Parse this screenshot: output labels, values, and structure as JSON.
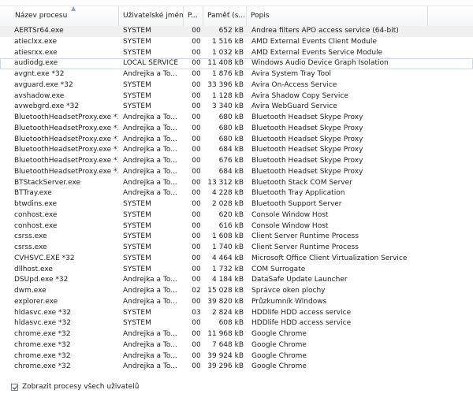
{
  "columns": {
    "name": "Název procesu",
    "user": "Uživatelské jméno",
    "priority": "P...",
    "memory": "Paměť (s...",
    "description": "Popis"
  },
  "rows": [
    {
      "name": "AERTSr64.exe",
      "user": "SYSTEM",
      "priority": "00",
      "memory": "652 kB",
      "description": "Andrea filters APO access service (64-bit)"
    },
    {
      "name": "atieclxx.exe",
      "user": "SYSTEM",
      "priority": "00",
      "memory": "1 516 kB",
      "description": "AMD External Events Client Module"
    },
    {
      "name": "atiesrxx.exe",
      "user": "SYSTEM",
      "priority": "00",
      "memory": "1 032 kB",
      "description": "AMD External Events Service Module"
    },
    {
      "name": "audiodg.exe",
      "user": "LOCAL SERVICE",
      "priority": "00",
      "memory": "11 408 kB",
      "description": "Windows Audio Device Graph Isolation"
    },
    {
      "name": "avgnt.exe *32",
      "user": "Andrejka a To...",
      "priority": "00",
      "memory": "1 876 kB",
      "description": "Avira System Tray Tool"
    },
    {
      "name": "avguard.exe *32",
      "user": "SYSTEM",
      "priority": "00",
      "memory": "33 396 kB",
      "description": "Avira On-Access Service"
    },
    {
      "name": "avshadow.exe",
      "user": "SYSTEM",
      "priority": "00",
      "memory": "1 128 kB",
      "description": "Avira Shadow Copy Service"
    },
    {
      "name": "avwebgrd.exe *32",
      "user": "SYSTEM",
      "priority": "00",
      "memory": "3 340 kB",
      "description": "Avira WebGuard Service"
    },
    {
      "name": "BluetoothHeadsetProxy.exe *32",
      "user": "Andrejka a To...",
      "priority": "00",
      "memory": "680 kB",
      "description": "Bluetooth Headset Skype Proxy"
    },
    {
      "name": "BluetoothHeadsetProxy.exe *32",
      "user": "Andrejka a To...",
      "priority": "00",
      "memory": "680 kB",
      "description": "Bluetooth Headset Skype Proxy"
    },
    {
      "name": "BluetoothHeadsetProxy.exe *32",
      "user": "Andrejka a To...",
      "priority": "00",
      "memory": "680 kB",
      "description": "Bluetooth Headset Skype Proxy"
    },
    {
      "name": "BluetoothHeadsetProxy.exe *32",
      "user": "Andrejka a To...",
      "priority": "00",
      "memory": "684 kB",
      "description": "Bluetooth Headset Skype Proxy"
    },
    {
      "name": "BluetoothHeadsetProxy.exe *32",
      "user": "Andrejka a To...",
      "priority": "00",
      "memory": "676 kB",
      "description": "Bluetooth Headset Skype Proxy"
    },
    {
      "name": "BluetoothHeadsetProxy.exe *32",
      "user": "Andrejka a To...",
      "priority": "00",
      "memory": "684 kB",
      "description": "Bluetooth Headset Skype Proxy"
    },
    {
      "name": "BTStackServer.exe",
      "user": "Andrejka a To...",
      "priority": "00",
      "memory": "13 312 kB",
      "description": "Bluetooth Stack COM Server"
    },
    {
      "name": "BTTray.exe",
      "user": "Andrejka a To...",
      "priority": "00",
      "memory": "4 228 kB",
      "description": "Bluetooth Tray Application"
    },
    {
      "name": "btwdins.exe",
      "user": "SYSTEM",
      "priority": "00",
      "memory": "2 028 kB",
      "description": "Bluetooth Support Server"
    },
    {
      "name": "conhost.exe",
      "user": "SYSTEM",
      "priority": "00",
      "memory": "620 kB",
      "description": "Console Window Host"
    },
    {
      "name": "conhost.exe",
      "user": "SYSTEM",
      "priority": "00",
      "memory": "616 kB",
      "description": "Console Window Host"
    },
    {
      "name": "csrss.exe",
      "user": "SYSTEM",
      "priority": "00",
      "memory": "1 608 kB",
      "description": "Client Server Runtime Process"
    },
    {
      "name": "csrss.exe",
      "user": "SYSTEM",
      "priority": "00",
      "memory": "1 740 kB",
      "description": "Client Server Runtime Process"
    },
    {
      "name": "CVHSVC.EXE *32",
      "user": "SYSTEM",
      "priority": "00",
      "memory": "4 464 kB",
      "description": "Microsoft Office Client Virtualization Service"
    },
    {
      "name": "dllhost.exe",
      "user": "SYSTEM",
      "priority": "00",
      "memory": "1 732 kB",
      "description": "COM Surrogate"
    },
    {
      "name": "DSUpd.exe *32",
      "user": "Andrejka a To...",
      "priority": "00",
      "memory": "4 184 kB",
      "description": "DataSafe Update Launcher"
    },
    {
      "name": "dwm.exe",
      "user": "Andrejka a To...",
      "priority": "02",
      "memory": "15 028 kB",
      "description": "Správce oken plochy"
    },
    {
      "name": "explorer.exe",
      "user": "Andrejka a To...",
      "priority": "00",
      "memory": "39 820 kB",
      "description": "Průzkumník Windows"
    },
    {
      "name": "hldasvc.exe *32",
      "user": "SYSTEM",
      "priority": "03",
      "memory": "2 824 kB",
      "description": "HDDlife HDD access service"
    },
    {
      "name": "hldasvc.exe *32",
      "user": "SYSTEM",
      "priority": "00",
      "memory": "608 kB",
      "description": "HDDlife HDD access service"
    },
    {
      "name": "chrome.exe *32",
      "user": "Andrejka a To...",
      "priority": "00",
      "memory": "11 968 kB",
      "description": "Google Chrome"
    },
    {
      "name": "chrome.exe *32",
      "user": "Andrejka a To...",
      "priority": "00",
      "memory": "7 648 kB",
      "description": "Google Chrome"
    },
    {
      "name": "chrome.exe *32",
      "user": "Andrejka a To...",
      "priority": "00",
      "memory": "39 924 kB",
      "description": "Google Chrome"
    },
    {
      "name": "chrome.exe *32",
      "user": "Andrejka a To...",
      "priority": "00",
      "memory": "39 296 kB",
      "description": "Google Chrome"
    }
  ],
  "selected_row": 0,
  "hover_row": 3,
  "footer": {
    "show_all_label": "Zobrazit procesy všech uživatelů",
    "show_all_checked": true
  },
  "colors": {
    "selected_row_bg": "#f0f0f0",
    "hover_row_border": "#c6dcf3",
    "sort_arrow": "#8aa8c8"
  }
}
